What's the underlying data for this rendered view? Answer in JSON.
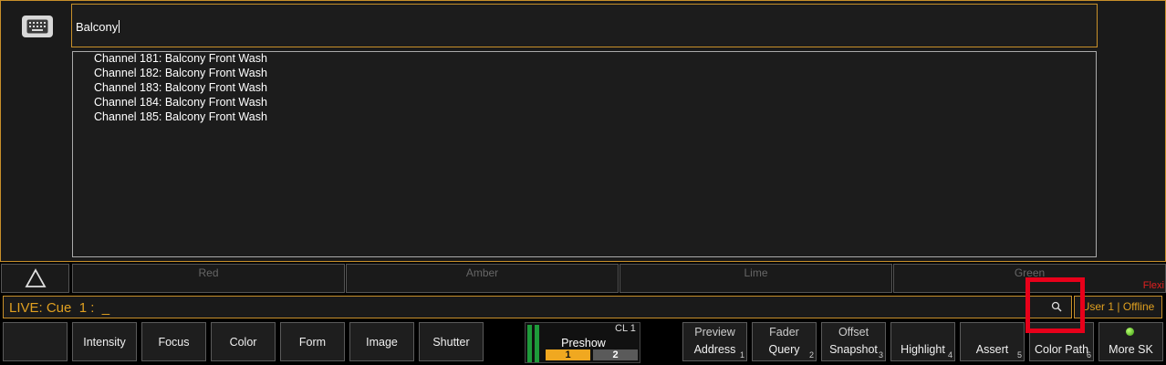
{
  "search": {
    "value": "Balcony"
  },
  "results": [
    "Channel 181: Balcony Front Wash",
    "Channel 182: Balcony Front Wash",
    "Channel 183: Balcony Front Wash",
    "Channel 184: Balcony Front Wash",
    "Channel 185: Balcony Front Wash"
  ],
  "flexi": {
    "label": "Flexi",
    "cells": [
      "Red",
      "Amber",
      "Lime",
      "Green"
    ]
  },
  "command_line": {
    "text": "LIVE: Cue  1 :  _"
  },
  "user_status": "User 1 | Offline",
  "softkeys_left": [
    "Intensity",
    "Focus",
    "Color",
    "Form",
    "Image",
    "Shutter"
  ],
  "cue_list": {
    "label": "CL 1",
    "name": "Preshow",
    "cues": [
      "1",
      "2"
    ]
  },
  "softkeys_right": [
    {
      "line1": "Preview",
      "line2": "Address",
      "num": "1"
    },
    {
      "line1": "Fader",
      "line2": "Query",
      "num": "2"
    },
    {
      "line1": "Offset",
      "line2": "Snapshot",
      "num": "3"
    },
    {
      "line1": "",
      "line2": "Highlight",
      "num": "4"
    },
    {
      "line1": "",
      "line2": "Assert",
      "num": "5"
    },
    {
      "line1": "",
      "line2": "Color Path",
      "num": "6"
    },
    {
      "line1": "",
      "line2": "More SK",
      "num": ""
    }
  ],
  "colors": {
    "accent": "#c8902a",
    "command_text": "#e0a020",
    "highlight": "#e8001a",
    "cue_active": "#f0a820",
    "cue_inactive": "#5a5a5a"
  },
  "icons": {
    "keyboard": "keyboard-icon",
    "triangle": "triangle-icon",
    "search": "search-icon",
    "led": "status-led-icon"
  }
}
